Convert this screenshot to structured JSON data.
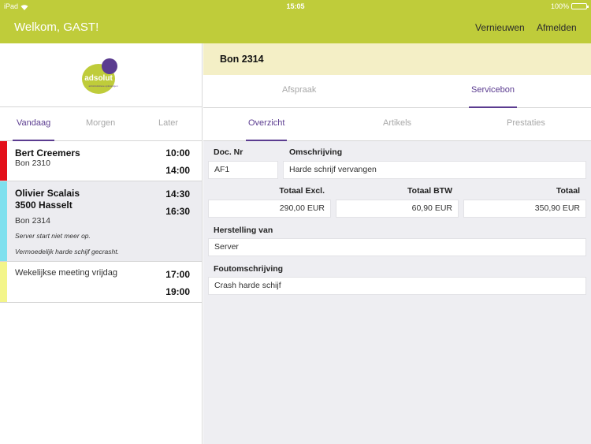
{
  "status_bar": {
    "carrier": "iPad",
    "time": "15:05",
    "battery": "100%",
    "battery_level": 1.0
  },
  "header": {
    "welcome": "Welkom, GAST!",
    "refresh_label": "Vernieuwen",
    "logout_label": "Afmelden"
  },
  "logo": {
    "text": "adsolut",
    "tagline": "administratieve oplossingen"
  },
  "day_tabs": [
    {
      "label": "Vandaag",
      "active": true
    },
    {
      "label": "Morgen",
      "active": false
    },
    {
      "label": "Later",
      "active": false
    }
  ],
  "appointments": [
    {
      "title": "Bert Creemers",
      "subtitle": "Bon 2310",
      "start": "10:00",
      "end": "14:00",
      "color": "#e3101a"
    },
    {
      "title": "Olivier Scalais",
      "title2": "3500 Hasselt",
      "subtitle": "Bon 2314",
      "note1": "Server start niet meer op.",
      "note2": "Vermoedelijk harde schijf gecrasht.",
      "start": "14:30",
      "end": "16:30",
      "color": "#7fe0ee",
      "selected": true
    },
    {
      "title": "Wekelijkse meeting vrijdag",
      "start": "17:00",
      "end": "19:00",
      "color": "#f3f58a"
    }
  ],
  "detail": {
    "title": "Bon 2314",
    "tabs_top": [
      {
        "label": "Afspraak",
        "active": false
      },
      {
        "label": "Servicebon",
        "active": true
      }
    ],
    "tabs_sub": [
      {
        "label": "Overzicht",
        "active": true
      },
      {
        "label": "Artikels",
        "active": false
      },
      {
        "label": "Prestaties",
        "active": false
      }
    ],
    "doc_nr_label": "Doc. Nr",
    "doc_nr": "AF1",
    "omschrijving_label": "Omschrijving",
    "omschrijving": "Harde schrijf vervangen",
    "totaal_excl_label": "Totaal Excl.",
    "totaal_excl": "290,00 EUR",
    "totaal_btw_label": "Totaal BTW",
    "totaal_btw": "60,90 EUR",
    "totaal_label": "Totaal",
    "totaal": "350,90 EUR",
    "herstelling_label": "Herstelling van",
    "herstelling": "Server",
    "fout_label": "Foutomschrijving",
    "fout": "Crash harde schijf"
  },
  "colors": {
    "brand_green": "#bfcc3a",
    "accent_purple": "#5b3c90",
    "header_yellow": "#f4efc6"
  }
}
